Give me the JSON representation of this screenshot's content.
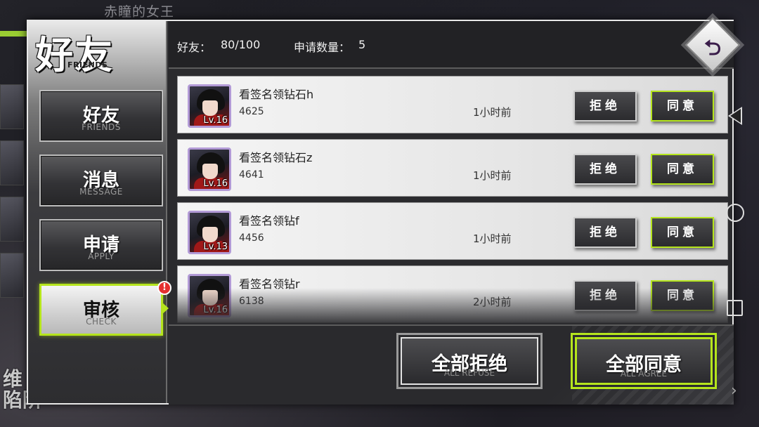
{
  "background": {
    "title": "赤瞳的女王",
    "bottom_text_line1": "维",
    "bottom_text_line2": "陷阱"
  },
  "dialog": {
    "title": "好友",
    "title_sub": "FRIENDS",
    "back_icon": "undo-arrow-icon",
    "accent_color": "#b5e51d"
  },
  "nav": [
    {
      "label": "好友",
      "sub": "FRIENDS"
    },
    {
      "label": "消息",
      "sub": "MESSAGE"
    },
    {
      "label": "申请",
      "sub": "APPLY"
    },
    {
      "label": "审核",
      "sub": "CHECK",
      "active": true,
      "badge": "!"
    }
  ],
  "header": {
    "friends_label": "好友：",
    "friends_count": "80/100",
    "requests_label": "申请数量：",
    "requests_count": "5"
  },
  "requests": [
    {
      "name": "看签名领钻石h",
      "id": "4625",
      "level": "Lv.16",
      "time": "1小时前"
    },
    {
      "name": "看签名领钻石z",
      "id": "4641",
      "level": "Lv.16",
      "time": "1小时前"
    },
    {
      "name": "看签名领钻f",
      "id": "4456",
      "level": "Lv.13",
      "time": "1小时前"
    },
    {
      "name": "看签名领钻r",
      "id": "6138",
      "level": "Lv.16",
      "time": "2小时前"
    }
  ],
  "row_buttons": {
    "refuse": "拒绝",
    "agree": "同意"
  },
  "footer": {
    "refuse_all": "全部拒绝",
    "refuse_all_sub": "ALL REFUSE",
    "agree_all": "全部同意",
    "agree_all_sub": "ALL AGREE"
  }
}
